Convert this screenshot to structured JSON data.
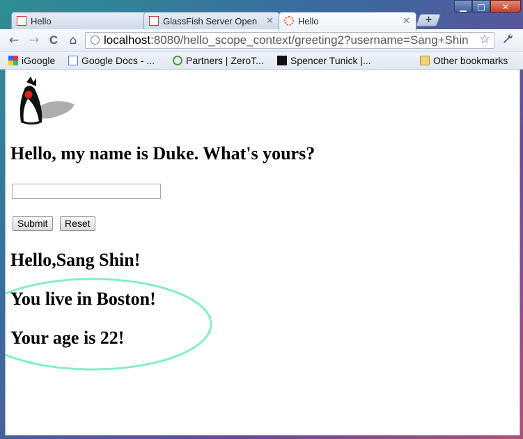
{
  "tabs": [
    {
      "label": "Hello",
      "active": false
    },
    {
      "label": "GlassFish Server Open",
      "active": false
    },
    {
      "label": "Hello",
      "active": true
    }
  ],
  "window_controls": {
    "minimize": "▁",
    "maximize": "□",
    "close": "✕"
  },
  "toolbar": {
    "back": "←",
    "forward": "→",
    "reload": "C",
    "home": "⌂",
    "url_host": "localhost",
    "url_rest": ":8080/hello_scope_context/greeting2?username=Sang+Shin",
    "star": "☆",
    "wrench": "🔧"
  },
  "bookmarks": [
    {
      "label": "iGoogle",
      "icon": "google-icon"
    },
    {
      "label": "Google Docs - ...",
      "icon": "docs-icon"
    },
    {
      "label": "Partners | ZeroT...",
      "icon": "partners-icon"
    },
    {
      "label": "Spencer Tunick |...",
      "icon": "tunick-icon"
    },
    {
      "label": "Other bookmarks",
      "icon": "folder-icon"
    }
  ],
  "page": {
    "prompt": "Hello, my name is Duke. What's yours?",
    "input_value": "",
    "submit_label": "Submit",
    "reset_label": "Reset",
    "greeting": "Hello,Sang Shin!",
    "location": "You live in Boston!",
    "age": "Your age is 22!"
  },
  "colors": {
    "annotation_ellipse": "#7ff0c0"
  }
}
